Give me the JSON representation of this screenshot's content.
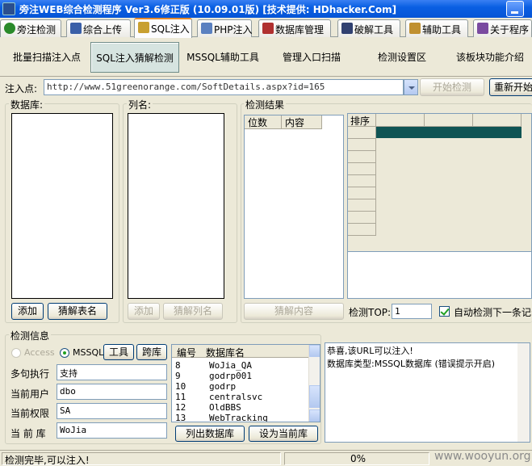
{
  "window": {
    "title": "旁注WEB综合检测程序 Ver3.6修正版 (10.09.01版) [技术提供: HDhacker.Com]"
  },
  "tabs": [
    {
      "label": "旁注检测",
      "color": "#2a8a2a"
    },
    {
      "label": "综合上传",
      "color": "#3a5fa8"
    },
    {
      "label": "SQL注入",
      "color": "#c8a030"
    },
    {
      "label": "PHP注入",
      "color": "#5a80c0"
    },
    {
      "label": "数据库管理",
      "color": "#b03030"
    },
    {
      "label": "破解工具",
      "color": "#304070"
    },
    {
      "label": "辅助工具",
      "color": "#c09030"
    },
    {
      "label": "关于程序",
      "color": "#7a4aa0"
    }
  ],
  "subtabs": [
    "批量扫描注入点",
    "SQL注入猜解检测",
    "MSSQL辅助工具",
    "管理入口扫描",
    "检测设置区",
    "该板块功能介绍"
  ],
  "url": {
    "label": "注入点:",
    "value": "http://www.51greenorange.com/SoftDetails.aspx?id=165",
    "start_button": "开始检测",
    "rescan_button": "重新开始"
  },
  "database_group": {
    "title": "数据库:",
    "add_button": "添加",
    "guess_button": "猜解表名"
  },
  "column_group": {
    "title": "列名:",
    "add_button": "添加",
    "guess_button": "猜解列名"
  },
  "result_group": {
    "title": "检测结果",
    "col_count": "位数",
    "col_content": "内容",
    "grid_header": "排序",
    "guess_content_button": "猜解内容",
    "top_label": "检测TOP:",
    "top_value": "1",
    "auto_next_label": "自动检测下一条记录",
    "auto_next_checked": true
  },
  "info_group": {
    "title": "检测信息",
    "access_label": "Access",
    "mssql_label": "MSSQL",
    "tools_button": "工具",
    "cross_db_button": "跨库",
    "multi_exec_label": "多句执行",
    "multi_exec_value": "支持",
    "current_user_label": "当前用户",
    "current_user_value": "dbo",
    "current_perm_label": "当前权限",
    "current_perm_value": "SA",
    "current_db_label": "当 前 库",
    "current_db_value": "WoJia"
  },
  "db_list": {
    "col_id": "编号",
    "col_name": "数据库名",
    "rows": [
      {
        "id": "8",
        "name": "WoJia_QA"
      },
      {
        "id": "9",
        "name": "godrp001"
      },
      {
        "id": "10",
        "name": "godrp"
      },
      {
        "id": "11",
        "name": "centralsvc"
      },
      {
        "id": "12",
        "name": "OldBBS"
      },
      {
        "id": "13",
        "name": "WebTracking"
      }
    ],
    "list_button": "列出数据库",
    "set_current_button": "设为当前库"
  },
  "messages": {
    "line1": "恭喜,该URL可以注入!",
    "line2": "数据库类型:MSSQL数据库 (错误提示开启)"
  },
  "status": {
    "text": "检测完毕,可以注入!",
    "progress": "0%",
    "watermark": "www.wooyun.org"
  }
}
